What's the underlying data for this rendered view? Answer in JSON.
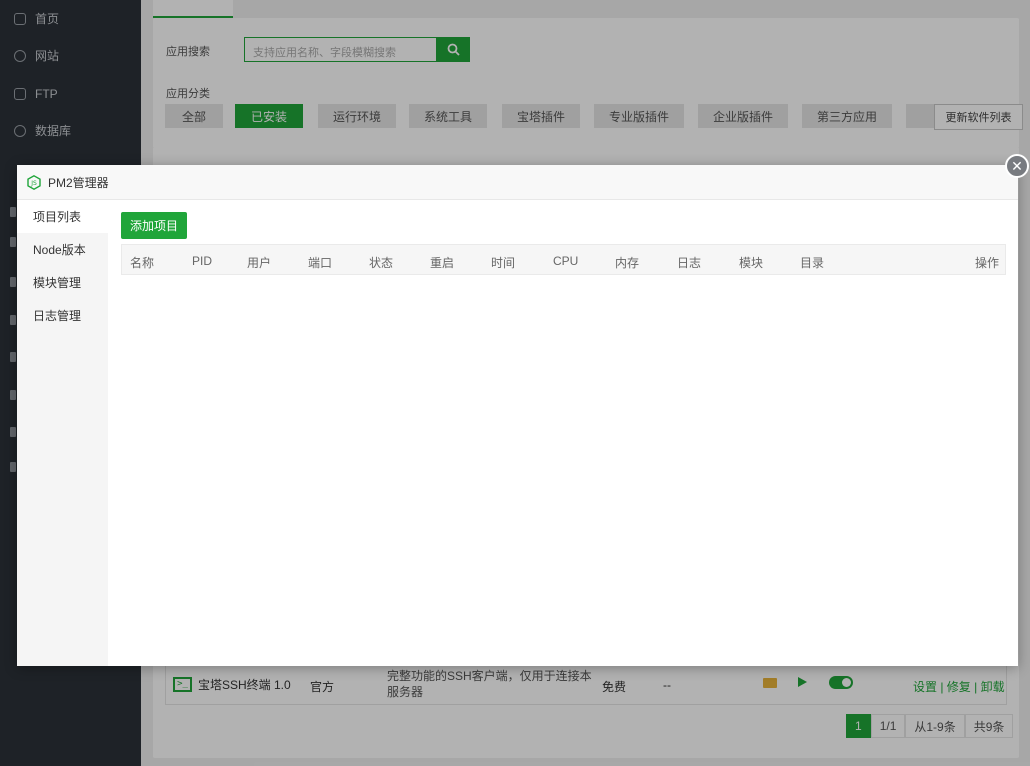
{
  "sidebar": {
    "items": [
      {
        "label": "首页"
      },
      {
        "label": "网站"
      },
      {
        "label": "FTP"
      },
      {
        "label": "数据库"
      }
    ]
  },
  "background": {
    "search_label": "应用搜索",
    "search_placeholder": "支持应用名称、字段模糊搜索",
    "category_label": "应用分类",
    "categories": [
      "全部",
      "已安装",
      "运行环境",
      "系统工具",
      "宝塔插件",
      "专业版插件",
      "企业版插件",
      "第三方应用"
    ],
    "update_button": "更新软件列表",
    "row": {
      "name": "宝塔SSH终端 1.0",
      "developer": "官方",
      "description": "完整功能的SSH客户端，仅用于连接本服务器",
      "price": "免费",
      "expire": "--",
      "ops": "设置 | 修复 | 卸载"
    },
    "pager": {
      "current": "1",
      "pages": "1/1",
      "range": "从1-9条",
      "total": "共9条"
    }
  },
  "modal": {
    "title": "PM2管理器",
    "close_icon": "close-icon",
    "side_items": [
      "项目列表",
      "Node版本",
      "模块管理",
      "日志管理"
    ],
    "add_button": "添加项目",
    "columns": [
      "名称",
      "PID",
      "用户",
      "端口",
      "状态",
      "重启",
      "时间",
      "CPU",
      "内存",
      "日志",
      "模块",
      "目录",
      "操作"
    ]
  },
  "colors": {
    "accent": "#20a53a",
    "sidebar_bg": "#2c3138"
  }
}
